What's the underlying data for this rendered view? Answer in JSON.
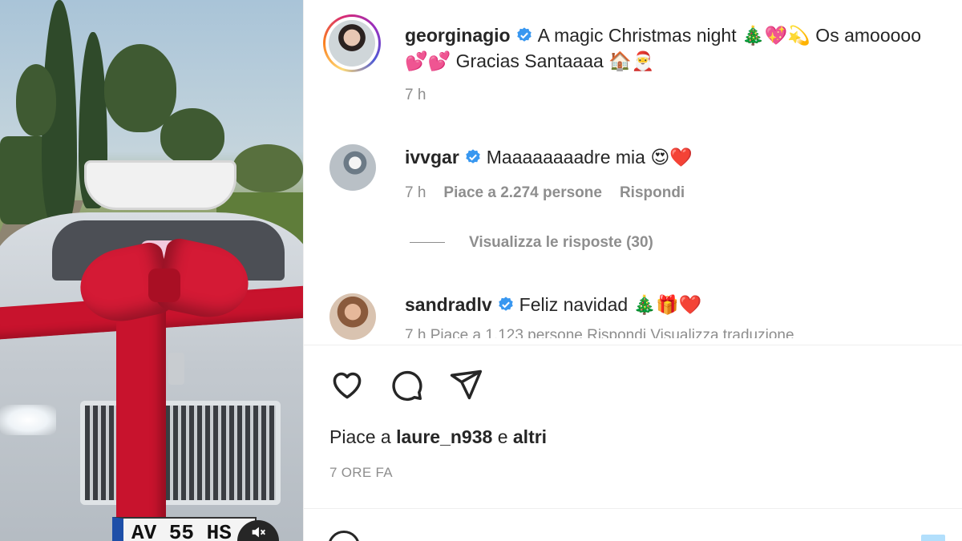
{
  "post": {
    "author": "georginagio",
    "caption_line1": "A magic Christmas night 🎄💖💫 Os amooooo",
    "caption_line2": "💕💕 Gracias Santaaaa 🏠🎅",
    "time": "7 h"
  },
  "comments": [
    {
      "username": "ivvgar",
      "text": "Maaaaaaaadre mia 😍❤️",
      "time": "7 h",
      "likes_label": "Piace a 2.274 persone",
      "reply_label": "Rispondi",
      "view_replies_label": "Visualizza le risposte (30)"
    },
    {
      "username": "sandradlv",
      "text": "Feliz navidad 🎄🎁❤️",
      "meta_cut": "7 h     Piace a 1.123 persone     Rispondi     Visualizza traduzione"
    }
  ],
  "likes_summary": {
    "prefix": "Piace a",
    "first_user": "laure_n938",
    "connector": "e",
    "others": "altri"
  },
  "time_ago": "7 ORE FA",
  "video": {
    "plate_text": "AV 55 HS",
    "mute_icon": "speaker-muted-icon"
  },
  "icons": {
    "like": "heart-icon",
    "comment": "comment-bubble-icon",
    "share": "paper-plane-icon",
    "verified": "verified-badge-icon"
  },
  "colors": {
    "verified": "#3897f0",
    "text": "#262626",
    "secondary": "#8e8e8e",
    "divider": "#efefef"
  }
}
